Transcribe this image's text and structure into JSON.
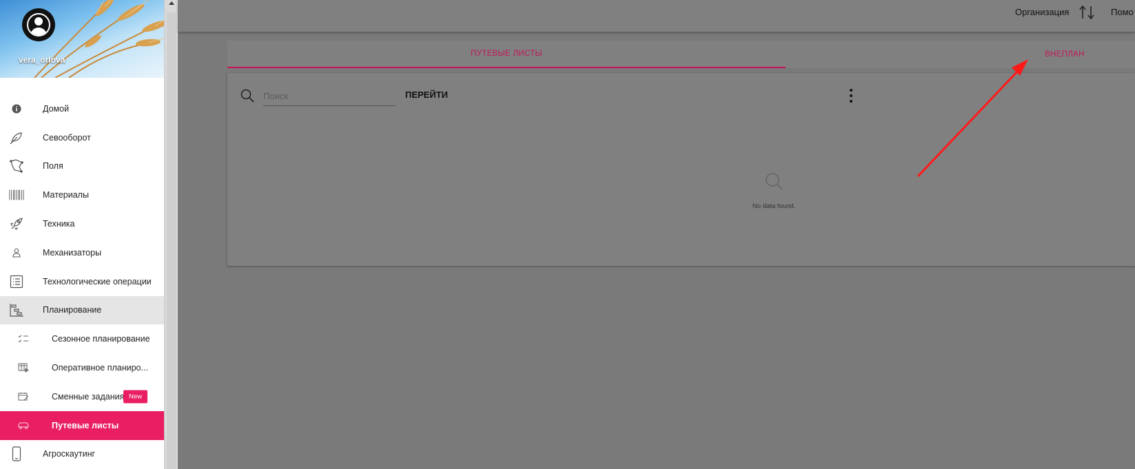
{
  "profile": {
    "username": "vera_orlova"
  },
  "menu": [
    {
      "label": "Домой",
      "icon": "info-icon"
    },
    {
      "label": "Севооборот",
      "icon": "leaf-icon"
    },
    {
      "label": "Поля",
      "icon": "field-map-icon"
    },
    {
      "label": "Материалы",
      "icon": "barcode-icon"
    },
    {
      "label": "Техника",
      "icon": "rocket-icon"
    },
    {
      "label": "Механизаторы",
      "icon": "person-icon"
    },
    {
      "label": "Технологические операции",
      "icon": "list-icon"
    },
    {
      "label": "Планирование",
      "icon": "planning-icon"
    },
    {
      "label": "Сезонное планирование",
      "icon": "checklist-icon"
    },
    {
      "label": "Оперативное планиро...",
      "icon": "calendar-play-icon"
    },
    {
      "label": "Сменные задания",
      "icon": "calendar-edit-icon",
      "badge": "New"
    },
    {
      "label": "Путевые листы",
      "icon": "car-icon"
    },
    {
      "label": "Агроскаутинг",
      "icon": "phone-icon"
    }
  ],
  "header": {
    "organization": "Организация",
    "help": "Помо"
  },
  "tabs": [
    {
      "label": "ПУТЕВЫЕ ЛИСТЫ",
      "active": true
    },
    {
      "label": "ВНЕПЛАН",
      "active": false
    }
  ],
  "toolbar": {
    "search_placeholder": "Поиск",
    "go_label": "ПЕРЕЙТИ"
  },
  "table": {
    "empty_message": "No data found."
  },
  "colors": {
    "accent": "#e91e63",
    "tab_text": "#c2185b",
    "overlay": "#808080",
    "annotation": "#ff1a1a"
  }
}
